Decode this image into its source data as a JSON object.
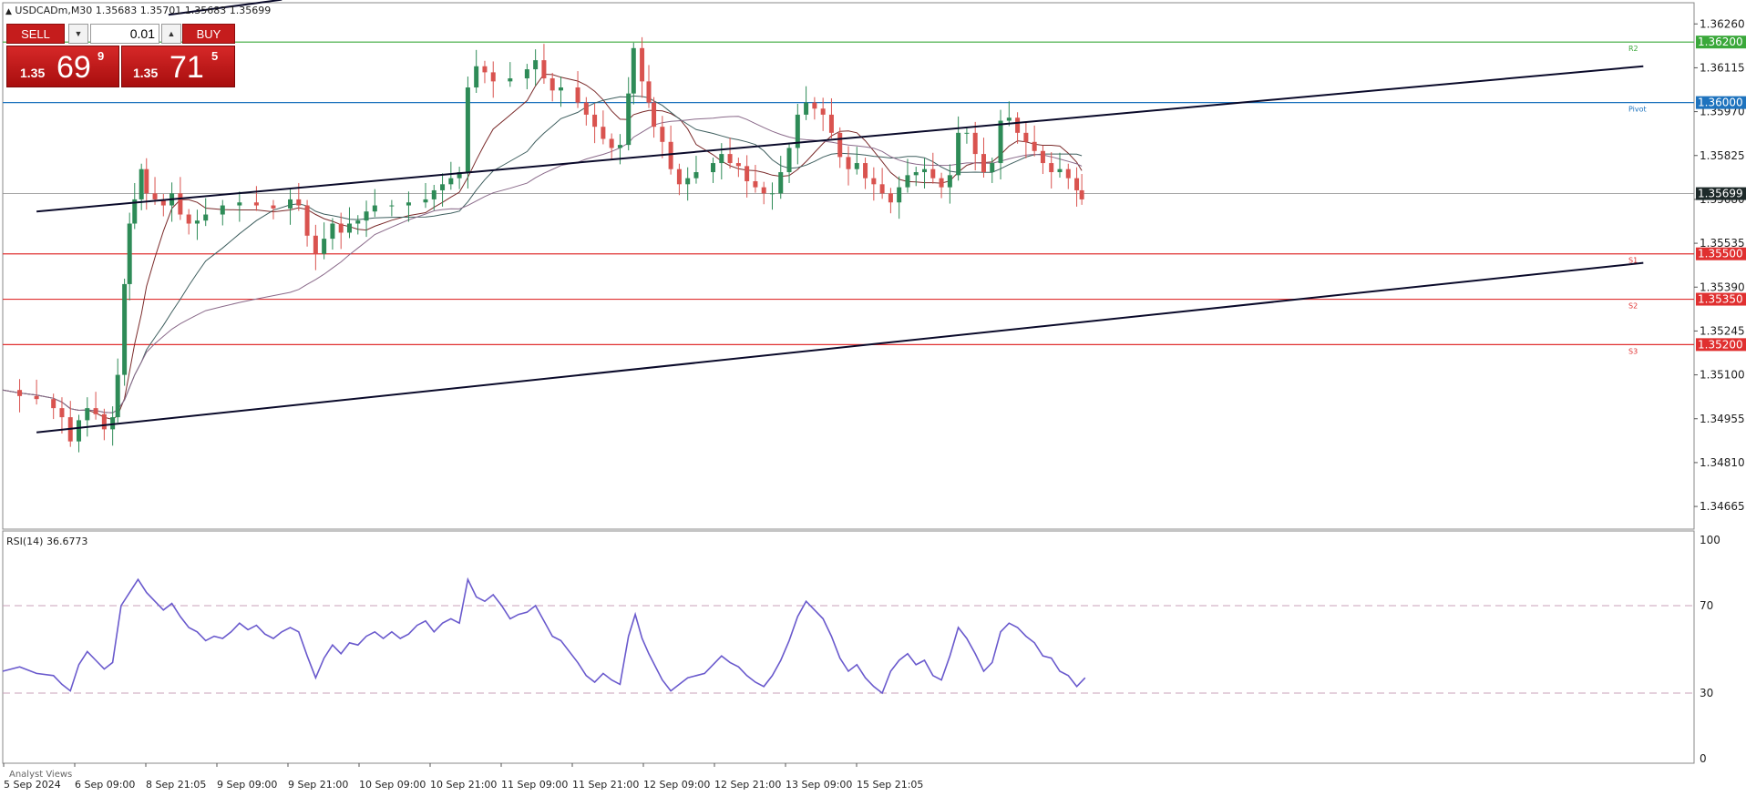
{
  "title": {
    "symbol_text": "USDCADm,M30  1.35683 1.35701 1.35683 1.35699"
  },
  "trade_panel": {
    "sell_label": "SELL",
    "buy_label": "BUY",
    "lot": "0.01",
    "sell_prefix": "1.35",
    "sell_big": "69",
    "sell_sup": "9",
    "buy_prefix": "1.35",
    "buy_big": "71",
    "buy_sup": "5"
  },
  "rsi": {
    "label": "RSI(14) 36.6773"
  },
  "analyst_views": "Analyst Views",
  "chart_data": [
    {
      "type": "candlestick",
      "title": "USDCADm,M30",
      "ylim": [
        1.3459,
        1.3633
      ],
      "y_ticks": [
        "1.36260",
        "1.36115",
        "1.35970",
        "1.35825",
        "1.35680",
        "1.35535",
        "1.35390",
        "1.35245",
        "1.35100",
        "1.34955",
        "1.34810",
        "1.34665"
      ],
      "x_ticks": [
        "5 Sep 2024",
        "6 Sep 09:00",
        "8 Sep 21:05",
        "9 Sep 09:00",
        "9 Sep 21:00",
        "10 Sep 09:00",
        "10 Sep 21:00",
        "11 Sep 09:00",
        "11 Sep 21:00",
        "12 Sep 09:00",
        "12 Sep 21:00",
        "13 Sep 09:00",
        "15 Sep 21:05"
      ],
      "current_price": {
        "value": 1.35699,
        "label": "1.35699"
      },
      "levels": [
        {
          "name": "R2",
          "value": 1.362,
          "label": "1.36200",
          "color": "#3aa83a"
        },
        {
          "name": "Pivot",
          "value": 1.36,
          "label": "1.36000",
          "color": "#1e73be"
        },
        {
          "name": "S1",
          "value": 1.355,
          "label": "1.35500",
          "color": "#e03030"
        },
        {
          "name": "S2",
          "value": 1.3535,
          "label": "1.35350",
          "color": "#e03030"
        },
        {
          "name": "S3",
          "value": 1.352,
          "label": "1.35200",
          "color": "#e03030"
        }
      ],
      "trendlines": [
        {
          "from": [
            0.02,
            1.3564
          ],
          "to": [
            0.97,
            1.3612
          ]
        },
        {
          "from": [
            0.02,
            1.3491
          ],
          "to": [
            0.97,
            1.3547
          ]
        },
        {
          "from": [
            0.098,
            1.3629
          ],
          "to": [
            0.165,
            1.3634
          ]
        }
      ],
      "close_path": [
        [
          0,
          1.3505
        ],
        [
          0.01,
          1.3503
        ],
        [
          0.02,
          1.3502
        ],
        [
          0.03,
          1.3499
        ],
        [
          0.035,
          1.3496
        ],
        [
          0.04,
          1.3488
        ],
        [
          0.045,
          1.3495
        ],
        [
          0.05,
          1.3499
        ],
        [
          0.055,
          1.3497
        ],
        [
          0.06,
          1.3492
        ],
        [
          0.065,
          1.3496
        ],
        [
          0.068,
          1.351
        ],
        [
          0.072,
          1.354
        ],
        [
          0.075,
          1.356
        ],
        [
          0.078,
          1.3568
        ],
        [
          0.082,
          1.3578
        ],
        [
          0.085,
          1.357
        ],
        [
          0.09,
          1.3568
        ],
        [
          0.095,
          1.3566
        ],
        [
          0.1,
          1.357
        ],
        [
          0.105,
          1.3563
        ],
        [
          0.11,
          1.356
        ],
        [
          0.115,
          1.3561
        ],
        [
          0.12,
          1.3563
        ],
        [
          0.13,
          1.3566
        ],
        [
          0.14,
          1.3567
        ],
        [
          0.15,
          1.3566
        ],
        [
          0.16,
          1.3565
        ],
        [
          0.17,
          1.3568
        ],
        [
          0.175,
          1.3566
        ],
        [
          0.18,
          1.3556
        ],
        [
          0.185,
          1.355
        ],
        [
          0.19,
          1.3555
        ],
        [
          0.195,
          1.356
        ],
        [
          0.2,
          1.3557
        ],
        [
          0.205,
          1.356
        ],
        [
          0.21,
          1.3561
        ],
        [
          0.215,
          1.3564
        ],
        [
          0.22,
          1.3566
        ],
        [
          0.23,
          1.3566
        ],
        [
          0.24,
          1.3567
        ],
        [
          0.25,
          1.3568
        ],
        [
          0.255,
          1.3571
        ],
        [
          0.26,
          1.3573
        ],
        [
          0.265,
          1.3575
        ],
        [
          0.27,
          1.3577
        ],
        [
          0.275,
          1.3605
        ],
        [
          0.28,
          1.3612
        ],
        [
          0.285,
          1.361
        ],
        [
          0.29,
          1.3607
        ],
        [
          0.3,
          1.3608
        ],
        [
          0.31,
          1.3611
        ],
        [
          0.315,
          1.3614
        ],
        [
          0.32,
          1.3608
        ],
        [
          0.325,
          1.3604
        ],
        [
          0.33,
          1.3605
        ],
        [
          0.34,
          1.36
        ],
        [
          0.345,
          1.3596
        ],
        [
          0.35,
          1.3592
        ],
        [
          0.355,
          1.3588
        ],
        [
          0.36,
          1.3585
        ],
        [
          0.365,
          1.3586
        ],
        [
          0.37,
          1.3603
        ],
        [
          0.373,
          1.3618
        ],
        [
          0.378,
          1.3607
        ],
        [
          0.382,
          1.36
        ],
        [
          0.385,
          1.3592
        ],
        [
          0.39,
          1.3587
        ],
        [
          0.395,
          1.3578
        ],
        [
          0.4,
          1.3573
        ],
        [
          0.405,
          1.3575
        ],
        [
          0.41,
          1.3577
        ],
        [
          0.42,
          1.358
        ],
        [
          0.425,
          1.3583
        ],
        [
          0.43,
          1.358
        ],
        [
          0.435,
          1.3579
        ],
        [
          0.44,
          1.3574
        ],
        [
          0.445,
          1.3572
        ],
        [
          0.45,
          1.357
        ],
        [
          0.455,
          1.357
        ],
        [
          0.46,
          1.3577
        ],
        [
          0.465,
          1.3585
        ],
        [
          0.47,
          1.3596
        ],
        [
          0.475,
          1.36
        ],
        [
          0.48,
          1.3598
        ],
        [
          0.485,
          1.3596
        ],
        [
          0.49,
          1.359
        ],
        [
          0.495,
          1.3582
        ],
        [
          0.5,
          1.3578
        ],
        [
          0.505,
          1.358
        ],
        [
          0.51,
          1.3575
        ],
        [
          0.515,
          1.3573
        ],
        [
          0.52,
          1.357
        ],
        [
          0.525,
          1.3567
        ],
        [
          0.53,
          1.3572
        ],
        [
          0.535,
          1.3576
        ],
        [
          0.54,
          1.3577
        ],
        [
          0.545,
          1.3578
        ],
        [
          0.55,
          1.3575
        ],
        [
          0.555,
          1.3572
        ],
        [
          0.56,
          1.3576
        ],
        [
          0.565,
          1.359
        ],
        [
          0.57,
          1.359
        ],
        [
          0.575,
          1.3583
        ],
        [
          0.58,
          1.3577
        ],
        [
          0.585,
          1.358
        ],
        [
          0.59,
          1.3594
        ],
        [
          0.595,
          1.3595
        ],
        [
          0.6,
          1.359
        ],
        [
          0.605,
          1.3587
        ],
        [
          0.61,
          1.3584
        ],
        [
          0.615,
          1.358
        ],
        [
          0.62,
          1.3577
        ],
        [
          0.625,
          1.3578
        ],
        [
          0.63,
          1.3575
        ],
        [
          0.635,
          1.3571
        ],
        [
          0.638,
          1.3568
        ]
      ]
    },
    {
      "type": "line",
      "title": "RSI(14) 36.6773",
      "ylim": [
        0,
        100
      ],
      "y_ticks": [
        "100",
        "70",
        "30",
        "0"
      ],
      "levels": [
        70,
        30
      ],
      "series": [
        {
          "color": "#6a5acd",
          "values": [
            [
              0,
              40
            ],
            [
              0.01,
              42
            ],
            [
              0.02,
              39
            ],
            [
              0.03,
              38
            ],
            [
              0.035,
              34
            ],
            [
              0.04,
              31
            ],
            [
              0.045,
              43
            ],
            [
              0.05,
              49
            ],
            [
              0.055,
              45
            ],
            [
              0.06,
              41
            ],
            [
              0.065,
              44
            ],
            [
              0.07,
              70
            ],
            [
              0.075,
              76
            ],
            [
              0.08,
              82
            ],
            [
              0.085,
              76
            ],
            [
              0.09,
              72
            ],
            [
              0.095,
              68
            ],
            [
              0.1,
              71
            ],
            [
              0.105,
              65
            ],
            [
              0.11,
              60
            ],
            [
              0.115,
              58
            ],
            [
              0.12,
              54
            ],
            [
              0.125,
              56
            ],
            [
              0.13,
              55
            ],
            [
              0.135,
              58
            ],
            [
              0.14,
              62
            ],
            [
              0.145,
              59
            ],
            [
              0.15,
              61
            ],
            [
              0.155,
              57
            ],
            [
              0.16,
              55
            ],
            [
              0.165,
              58
            ],
            [
              0.17,
              60
            ],
            [
              0.175,
              58
            ],
            [
              0.18,
              47
            ],
            [
              0.185,
              37
            ],
            [
              0.19,
              46
            ],
            [
              0.195,
              52
            ],
            [
              0.2,
              48
            ],
            [
              0.205,
              53
            ],
            [
              0.21,
              52
            ],
            [
              0.215,
              56
            ],
            [
              0.22,
              58
            ],
            [
              0.225,
              55
            ],
            [
              0.23,
              58
            ],
            [
              0.235,
              55
            ],
            [
              0.24,
              57
            ],
            [
              0.245,
              61
            ],
            [
              0.25,
              63
            ],
            [
              0.255,
              58
            ],
            [
              0.26,
              62
            ],
            [
              0.265,
              64
            ],
            [
              0.27,
              62
            ],
            [
              0.275,
              82
            ],
            [
              0.28,
              74
            ],
            [
              0.285,
              72
            ],
            [
              0.29,
              75
            ],
            [
              0.295,
              70
            ],
            [
              0.3,
              64
            ],
            [
              0.305,
              66
            ],
            [
              0.31,
              67
            ],
            [
              0.315,
              70
            ],
            [
              0.32,
              63
            ],
            [
              0.325,
              56
            ],
            [
              0.33,
              54
            ],
            [
              0.34,
              44
            ],
            [
              0.345,
              38
            ],
            [
              0.35,
              35
            ],
            [
              0.355,
              39
            ],
            [
              0.36,
              36
            ],
            [
              0.365,
              34
            ],
            [
              0.37,
              56
            ],
            [
              0.374,
              66
            ],
            [
              0.378,
              55
            ],
            [
              0.382,
              48
            ],
            [
              0.386,
              42
            ],
            [
              0.39,
              36
            ],
            [
              0.395,
              31
            ],
            [
              0.4,
              34
            ],
            [
              0.405,
              37
            ],
            [
              0.41,
              38
            ],
            [
              0.415,
              39
            ],
            [
              0.42,
              43
            ],
            [
              0.425,
              47
            ],
            [
              0.43,
              44
            ],
            [
              0.435,
              42
            ],
            [
              0.44,
              38
            ],
            [
              0.445,
              35
            ],
            [
              0.45,
              33
            ],
            [
              0.455,
              38
            ],
            [
              0.46,
              45
            ],
            [
              0.465,
              54
            ],
            [
              0.47,
              65
            ],
            [
              0.475,
              72
            ],
            [
              0.48,
              68
            ],
            [
              0.485,
              64
            ],
            [
              0.49,
              56
            ],
            [
              0.495,
              46
            ],
            [
              0.5,
              40
            ],
            [
              0.505,
              43
            ],
            [
              0.51,
              37
            ],
            [
              0.515,
              33
            ],
            [
              0.52,
              30
            ],
            [
              0.525,
              40
            ],
            [
              0.53,
              45
            ],
            [
              0.535,
              48
            ],
            [
              0.54,
              43
            ],
            [
              0.545,
              45
            ],
            [
              0.55,
              38
            ],
            [
              0.555,
              36
            ],
            [
              0.56,
              47
            ],
            [
              0.565,
              60
            ],
            [
              0.57,
              55
            ],
            [
              0.575,
              48
            ],
            [
              0.58,
              40
            ],
            [
              0.585,
              44
            ],
            [
              0.59,
              58
            ],
            [
              0.595,
              62
            ],
            [
              0.6,
              60
            ],
            [
              0.605,
              56
            ],
            [
              0.61,
              53
            ],
            [
              0.615,
              47
            ],
            [
              0.62,
              46
            ],
            [
              0.625,
              40
            ],
            [
              0.63,
              38
            ],
            [
              0.635,
              33
            ],
            [
              0.64,
              37
            ]
          ]
        }
      ]
    }
  ]
}
